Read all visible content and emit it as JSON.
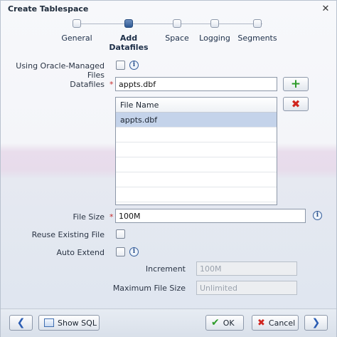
{
  "window": {
    "title": "Create Tablespace",
    "close_glyph": "✕"
  },
  "train": {
    "steps": [
      {
        "label": "General",
        "active": false
      },
      {
        "label": "Add Datafiles",
        "active": true
      },
      {
        "label": "Space",
        "active": false
      },
      {
        "label": "Logging",
        "active": false
      },
      {
        "label": "Segments",
        "active": false
      }
    ]
  },
  "form": {
    "omf_label": "Using Oracle-Managed Files",
    "datafiles_label": "Datafiles",
    "datafiles_value": "appts.dbf",
    "required_mark": "*",
    "file_size_label": "File Size",
    "file_size_value": "100M",
    "reuse_label": "Reuse Existing File",
    "auto_extend_label": "Auto Extend",
    "increment_label": "Increment",
    "increment_value": "100M",
    "max_size_label": "Maximum File Size",
    "max_size_value": "Unlimited",
    "info_glyph": "i"
  },
  "table": {
    "header": "File Name",
    "rows": [
      "appts.dbf",
      "",
      "",
      "",
      "",
      "",
      ""
    ]
  },
  "toolbar": {
    "add_glyph": "+",
    "remove_glyph": "✖"
  },
  "footer": {
    "back_glyph": "❮",
    "show_sql_label": "Show SQL",
    "ok_label": "OK",
    "ok_glyph": "✔",
    "cancel_label": "Cancel",
    "cancel_glyph": "✖",
    "next_glyph": "❯"
  },
  "colors": {
    "accent": "#2f5a94",
    "required": "#c52b2b",
    "add": "#2e9c2a",
    "remove": "#d0251f",
    "selection": "#c4d3ea"
  }
}
